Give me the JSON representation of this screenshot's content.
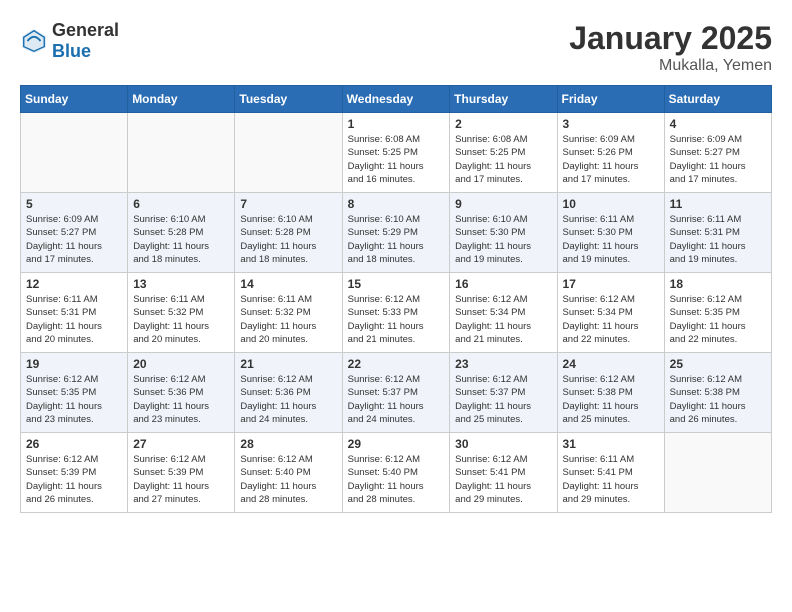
{
  "header": {
    "logo_general": "General",
    "logo_blue": "Blue",
    "month_year": "January 2025",
    "location": "Mukalla, Yemen"
  },
  "days_of_week": [
    "Sunday",
    "Monday",
    "Tuesday",
    "Wednesday",
    "Thursday",
    "Friday",
    "Saturday"
  ],
  "weeks": [
    [
      {
        "day": "",
        "info": ""
      },
      {
        "day": "",
        "info": ""
      },
      {
        "day": "",
        "info": ""
      },
      {
        "day": "1",
        "info": "Sunrise: 6:08 AM\nSunset: 5:25 PM\nDaylight: 11 hours\nand 16 minutes."
      },
      {
        "day": "2",
        "info": "Sunrise: 6:08 AM\nSunset: 5:25 PM\nDaylight: 11 hours\nand 17 minutes."
      },
      {
        "day": "3",
        "info": "Sunrise: 6:09 AM\nSunset: 5:26 PM\nDaylight: 11 hours\nand 17 minutes."
      },
      {
        "day": "4",
        "info": "Sunrise: 6:09 AM\nSunset: 5:27 PM\nDaylight: 11 hours\nand 17 minutes."
      }
    ],
    [
      {
        "day": "5",
        "info": "Sunrise: 6:09 AM\nSunset: 5:27 PM\nDaylight: 11 hours\nand 17 minutes."
      },
      {
        "day": "6",
        "info": "Sunrise: 6:10 AM\nSunset: 5:28 PM\nDaylight: 11 hours\nand 18 minutes."
      },
      {
        "day": "7",
        "info": "Sunrise: 6:10 AM\nSunset: 5:28 PM\nDaylight: 11 hours\nand 18 minutes."
      },
      {
        "day": "8",
        "info": "Sunrise: 6:10 AM\nSunset: 5:29 PM\nDaylight: 11 hours\nand 18 minutes."
      },
      {
        "day": "9",
        "info": "Sunrise: 6:10 AM\nSunset: 5:30 PM\nDaylight: 11 hours\nand 19 minutes."
      },
      {
        "day": "10",
        "info": "Sunrise: 6:11 AM\nSunset: 5:30 PM\nDaylight: 11 hours\nand 19 minutes."
      },
      {
        "day": "11",
        "info": "Sunrise: 6:11 AM\nSunset: 5:31 PM\nDaylight: 11 hours\nand 19 minutes."
      }
    ],
    [
      {
        "day": "12",
        "info": "Sunrise: 6:11 AM\nSunset: 5:31 PM\nDaylight: 11 hours\nand 20 minutes."
      },
      {
        "day": "13",
        "info": "Sunrise: 6:11 AM\nSunset: 5:32 PM\nDaylight: 11 hours\nand 20 minutes."
      },
      {
        "day": "14",
        "info": "Sunrise: 6:11 AM\nSunset: 5:32 PM\nDaylight: 11 hours\nand 20 minutes."
      },
      {
        "day": "15",
        "info": "Sunrise: 6:12 AM\nSunset: 5:33 PM\nDaylight: 11 hours\nand 21 minutes."
      },
      {
        "day": "16",
        "info": "Sunrise: 6:12 AM\nSunset: 5:34 PM\nDaylight: 11 hours\nand 21 minutes."
      },
      {
        "day": "17",
        "info": "Sunrise: 6:12 AM\nSunset: 5:34 PM\nDaylight: 11 hours\nand 22 minutes."
      },
      {
        "day": "18",
        "info": "Sunrise: 6:12 AM\nSunset: 5:35 PM\nDaylight: 11 hours\nand 22 minutes."
      }
    ],
    [
      {
        "day": "19",
        "info": "Sunrise: 6:12 AM\nSunset: 5:35 PM\nDaylight: 11 hours\nand 23 minutes."
      },
      {
        "day": "20",
        "info": "Sunrise: 6:12 AM\nSunset: 5:36 PM\nDaylight: 11 hours\nand 23 minutes."
      },
      {
        "day": "21",
        "info": "Sunrise: 6:12 AM\nSunset: 5:36 PM\nDaylight: 11 hours\nand 24 minutes."
      },
      {
        "day": "22",
        "info": "Sunrise: 6:12 AM\nSunset: 5:37 PM\nDaylight: 11 hours\nand 24 minutes."
      },
      {
        "day": "23",
        "info": "Sunrise: 6:12 AM\nSunset: 5:37 PM\nDaylight: 11 hours\nand 25 minutes."
      },
      {
        "day": "24",
        "info": "Sunrise: 6:12 AM\nSunset: 5:38 PM\nDaylight: 11 hours\nand 25 minutes."
      },
      {
        "day": "25",
        "info": "Sunrise: 6:12 AM\nSunset: 5:38 PM\nDaylight: 11 hours\nand 26 minutes."
      }
    ],
    [
      {
        "day": "26",
        "info": "Sunrise: 6:12 AM\nSunset: 5:39 PM\nDaylight: 11 hours\nand 26 minutes."
      },
      {
        "day": "27",
        "info": "Sunrise: 6:12 AM\nSunset: 5:39 PM\nDaylight: 11 hours\nand 27 minutes."
      },
      {
        "day": "28",
        "info": "Sunrise: 6:12 AM\nSunset: 5:40 PM\nDaylight: 11 hours\nand 28 minutes."
      },
      {
        "day": "29",
        "info": "Sunrise: 6:12 AM\nSunset: 5:40 PM\nDaylight: 11 hours\nand 28 minutes."
      },
      {
        "day": "30",
        "info": "Sunrise: 6:12 AM\nSunset: 5:41 PM\nDaylight: 11 hours\nand 29 minutes."
      },
      {
        "day": "31",
        "info": "Sunrise: 6:11 AM\nSunset: 5:41 PM\nDaylight: 11 hours\nand 29 minutes."
      },
      {
        "day": "",
        "info": ""
      }
    ]
  ]
}
